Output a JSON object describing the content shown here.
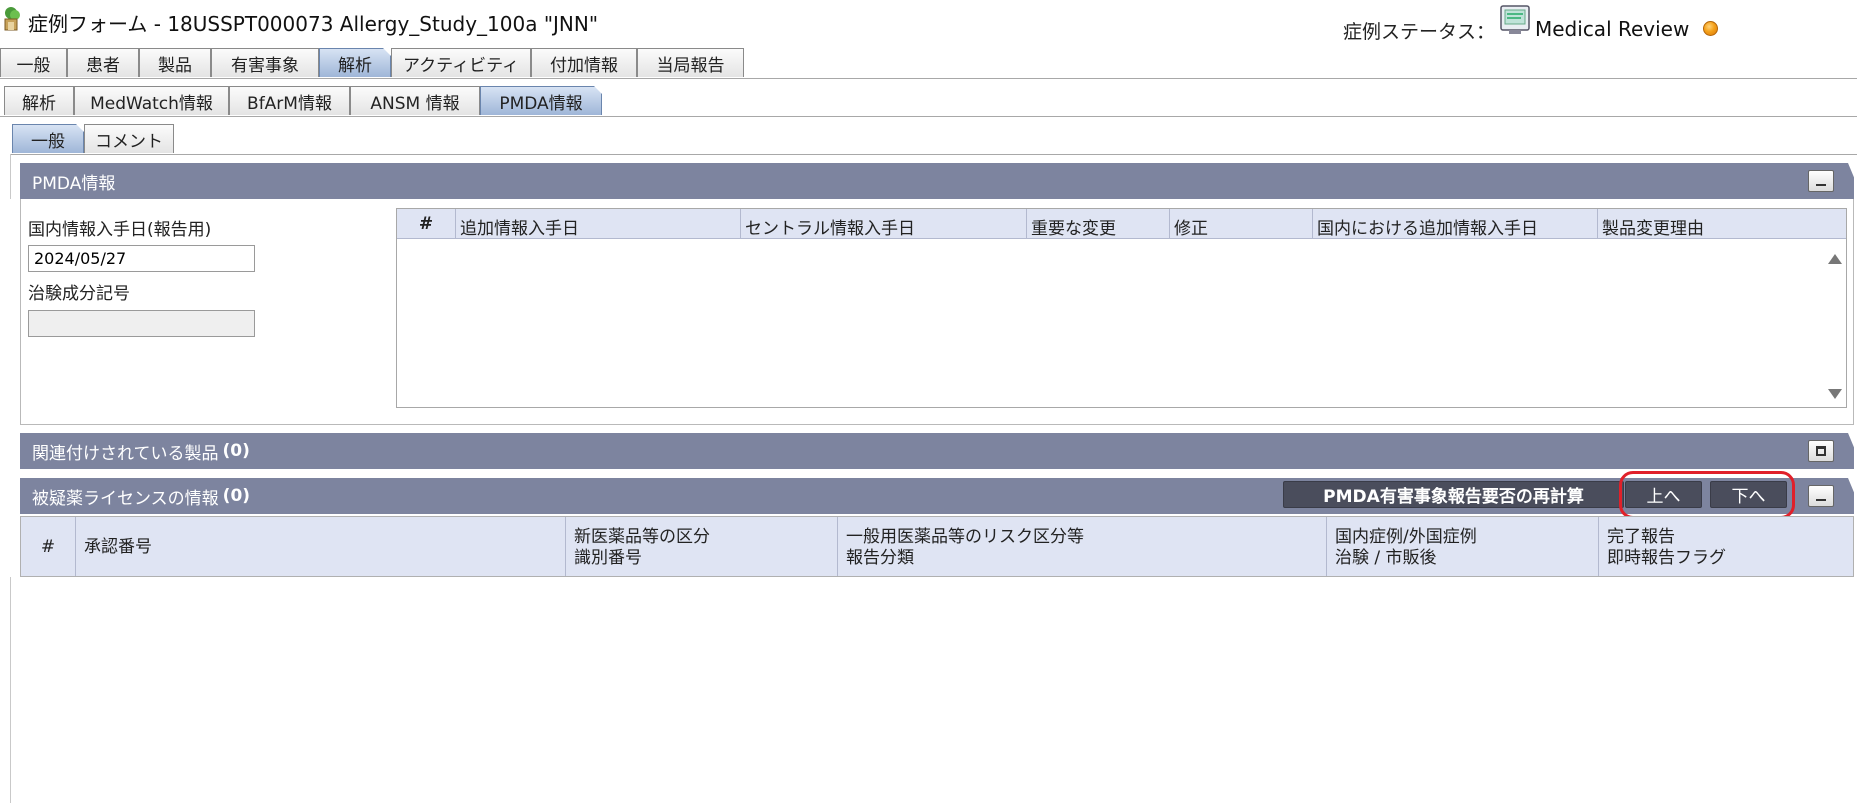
{
  "header": {
    "title": "症例フォーム - 18USSPT000073 Allergy_Study_100a \"JNN\"",
    "status_label": "症例ステータス：",
    "status_value": "Medical Review",
    "status_icon": "monitor-icon",
    "status_color": "#f4a11a"
  },
  "tabs_main": [
    {
      "label": "一般",
      "active": false
    },
    {
      "label": "患者",
      "active": false
    },
    {
      "label": "製品",
      "active": false
    },
    {
      "label": "有害事象",
      "active": false
    },
    {
      "label": "解析",
      "active": true
    },
    {
      "label": "アクティビティ",
      "active": false
    },
    {
      "label": "付加情報",
      "active": false
    },
    {
      "label": "当局報告",
      "active": false
    }
  ],
  "tabs_sub": [
    {
      "label": "解析",
      "active": false
    },
    {
      "label": "MedWatch情報",
      "active": false
    },
    {
      "label": "BfArM情報",
      "active": false
    },
    {
      "label": "ANSM 情報",
      "active": false
    },
    {
      "label": "PMDA情報",
      "active": true
    }
  ],
  "tabs_inner": [
    {
      "label": "一般",
      "active": true
    },
    {
      "label": "コメント",
      "active": false
    }
  ],
  "pmda_panel": {
    "title": "PMDA情報",
    "domestic_date_label": "国内情報入手日(報告用)",
    "domestic_date_value": "2024/05/27",
    "trial_code_label": "治験成分記号",
    "trial_code_value": "",
    "table_columns": [
      "#",
      "追加情報入手日",
      "セントラル情報入手日",
      "重要な変更",
      "修正",
      "国内における追加情報入手日",
      "製品変更理由"
    ]
  },
  "linked_products_panel": {
    "title": "関連付けされている製品",
    "count": "(0)"
  },
  "license_panel": {
    "title": "被疑薬ライセンスの情報",
    "count": "(0)",
    "recalc_label": "PMDA有害事象報告要否の再計算",
    "up_label": "上へ",
    "down_label": "下へ",
    "columns": [
      {
        "line1": "#",
        "line2": ""
      },
      {
        "line1": "承認番号",
        "line2": ""
      },
      {
        "line1": "新医薬品等の区分",
        "line2": "識別番号"
      },
      {
        "line1": "一般用医薬品等のリスク区分等",
        "line2": "報告分類"
      },
      {
        "line1": "国内症例/外国症例",
        "line2": "治験 / 市販後"
      },
      {
        "line1": "完了報告",
        "line2": "即時報告フラグ"
      }
    ]
  },
  "colors": {
    "panel_header": "#7d849f",
    "table_header": "#dfe4f3",
    "highlight": "#e0202a"
  }
}
